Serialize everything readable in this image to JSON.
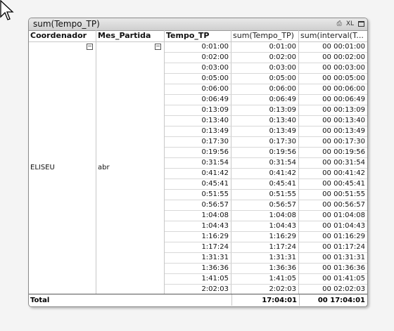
{
  "window": {
    "title": "sum(Tempo_TP)",
    "xl_label": "XL"
  },
  "columns": [
    "Coordenador",
    "Mes_Partida",
    "Tempo_TP",
    "sum(Tempo_TP)",
    "sum(interval(T..."
  ],
  "dimensions": {
    "coordenador": "ELISEU",
    "mes_partida": "abr"
  },
  "rows": [
    [
      "0:01:00",
      "0:01:00",
      "00 00:01:00"
    ],
    [
      "0:02:00",
      "0:02:00",
      "00 00:02:00"
    ],
    [
      "0:03:00",
      "0:03:00",
      "00 00:03:00"
    ],
    [
      "0:05:00",
      "0:05:00",
      "00 00:05:00"
    ],
    [
      "0:06:00",
      "0:06:00",
      "00 00:06:00"
    ],
    [
      "0:06:49",
      "0:06:49",
      "00 00:06:49"
    ],
    [
      "0:13:09",
      "0:13:09",
      "00 00:13:09"
    ],
    [
      "0:13:40",
      "0:13:40",
      "00 00:13:40"
    ],
    [
      "0:13:49",
      "0:13:49",
      "00 00:13:49"
    ],
    [
      "0:17:30",
      "0:17:30",
      "00 00:17:30"
    ],
    [
      "0:19:56",
      "0:19:56",
      "00 00:19:56"
    ],
    [
      "0:31:54",
      "0:31:54",
      "00 00:31:54"
    ],
    [
      "0:41:42",
      "0:41:42",
      "00 00:41:42"
    ],
    [
      "0:45:41",
      "0:45:41",
      "00 00:45:41"
    ],
    [
      "0:51:55",
      "0:51:55",
      "00 00:51:55"
    ],
    [
      "0:56:57",
      "0:56:57",
      "00 00:56:57"
    ],
    [
      "1:04:08",
      "1:04:08",
      "00 01:04:08"
    ],
    [
      "1:04:43",
      "1:04:43",
      "00 01:04:43"
    ],
    [
      "1:16:29",
      "1:16:29",
      "00 01:16:29"
    ],
    [
      "1:17:24",
      "1:17:24",
      "00 01:17:24"
    ],
    [
      "1:31:31",
      "1:31:31",
      "00 01:31:31"
    ],
    [
      "1:36:36",
      "1:36:36",
      "00 01:36:36"
    ],
    [
      "1:41:05",
      "1:41:05",
      "00 01:41:05"
    ],
    [
      "2:02:03",
      "2:02:03",
      "00 02:02:03"
    ]
  ],
  "total": {
    "label": "Total",
    "sum_tempo": "17:04:01",
    "sum_interval": "00 17:04:01"
  },
  "icons": {
    "cursor": "arrow-cursor-icon",
    "print": "print-icon",
    "maximize": "maximize-icon",
    "collapse": "collapse-minus-icon"
  },
  "colors": {
    "background": "#f4f4f4",
    "caption_top": "#e9e9e9",
    "caption_bottom": "#cfcfcf",
    "border": "#8a8a8a"
  }
}
